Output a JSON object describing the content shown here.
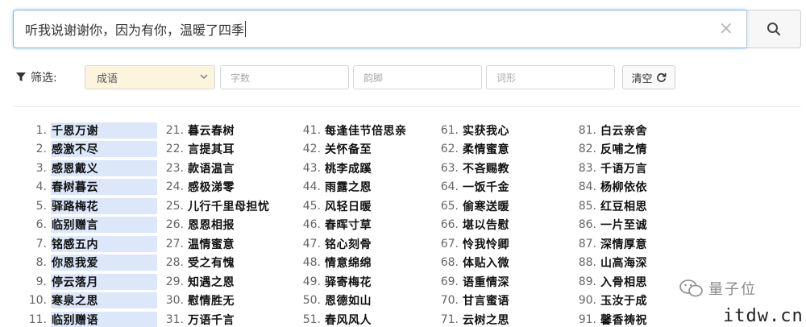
{
  "search": {
    "query": "听我说谢谢你，因为有你，温暖了四季",
    "clear_icon": "×"
  },
  "filters": {
    "label": "筛选:",
    "category_selected": "成语",
    "count_placeholder": "字数",
    "rhyme_placeholder": "韵脚",
    "shape_placeholder": "词形",
    "clear_label": "清空"
  },
  "results": {
    "columns": [
      {
        "items": [
          {
            "num": "1.",
            "text": "千恩万谢"
          },
          {
            "num": "2.",
            "text": "感激不尽"
          },
          {
            "num": "3.",
            "text": "感恩戴义"
          },
          {
            "num": "4.",
            "text": "春树暮云"
          },
          {
            "num": "5.",
            "text": "驿路梅花"
          },
          {
            "num": "6.",
            "text": "临别赠言"
          },
          {
            "num": "7.",
            "text": "铭感五内"
          },
          {
            "num": "8.",
            "text": "你恩我爱"
          },
          {
            "num": "9.",
            "text": "停云落月"
          },
          {
            "num": "10.",
            "text": "寒泉之思"
          },
          {
            "num": "11.",
            "text": "临别赠语"
          }
        ]
      },
      {
        "items": [
          {
            "num": "21.",
            "text": "暮云春树"
          },
          {
            "num": "22.",
            "text": "言提其耳"
          },
          {
            "num": "23.",
            "text": "款语温言"
          },
          {
            "num": "24.",
            "text": "感极涕零"
          },
          {
            "num": "25.",
            "text": "儿行千里母担忧"
          },
          {
            "num": "26.",
            "text": "恩恩相报"
          },
          {
            "num": "27.",
            "text": "温情蜜意"
          },
          {
            "num": "28.",
            "text": "受之有愧"
          },
          {
            "num": "29.",
            "text": "知遇之恩"
          },
          {
            "num": "30.",
            "text": "慰情胜无"
          },
          {
            "num": "31.",
            "text": "万语千言"
          }
        ]
      },
      {
        "items": [
          {
            "num": "41.",
            "text": "每逢佳节倍思亲"
          },
          {
            "num": "42.",
            "text": "关怀备至"
          },
          {
            "num": "43.",
            "text": "桃李成蹊"
          },
          {
            "num": "44.",
            "text": "雨露之恩"
          },
          {
            "num": "45.",
            "text": "风轻日暖"
          },
          {
            "num": "46.",
            "text": "春晖寸草"
          },
          {
            "num": "47.",
            "text": "铭心刻骨"
          },
          {
            "num": "48.",
            "text": "情意绵绵"
          },
          {
            "num": "49.",
            "text": "驿寄梅花"
          },
          {
            "num": "50.",
            "text": "恩德如山"
          },
          {
            "num": "51.",
            "text": "春风风人"
          }
        ]
      },
      {
        "items": [
          {
            "num": "61.",
            "text": "实获我心"
          },
          {
            "num": "62.",
            "text": "柔情蜜意"
          },
          {
            "num": "63.",
            "text": "不吝赐教"
          },
          {
            "num": "64.",
            "text": "一饭千金"
          },
          {
            "num": "65.",
            "text": "偷寒送暖"
          },
          {
            "num": "66.",
            "text": "堪以告慰"
          },
          {
            "num": "67.",
            "text": "怜我怜卿"
          },
          {
            "num": "68.",
            "text": "体贴入微"
          },
          {
            "num": "69.",
            "text": "语重情深"
          },
          {
            "num": "70.",
            "text": "甘言蜜语"
          },
          {
            "num": "71.",
            "text": "云树之思"
          }
        ]
      },
      {
        "items": [
          {
            "num": "81.",
            "text": "白云亲舍"
          },
          {
            "num": "82.",
            "text": "反哺之情"
          },
          {
            "num": "83.",
            "text": "千语万言"
          },
          {
            "num": "84.",
            "text": "杨柳依依"
          },
          {
            "num": "85.",
            "text": "红豆相思"
          },
          {
            "num": "86.",
            "text": "一片至诚"
          },
          {
            "num": "87.",
            "text": "深情厚意"
          },
          {
            "num": "88.",
            "text": "山高海深"
          },
          {
            "num": "89.",
            "text": "入骨相思"
          },
          {
            "num": "90.",
            "text": "玉汝于成"
          },
          {
            "num": "91.",
            "text": "馨香祷祝"
          }
        ]
      }
    ]
  },
  "watermark": {
    "brand": "量子位",
    "site": "itdw.cn"
  }
}
